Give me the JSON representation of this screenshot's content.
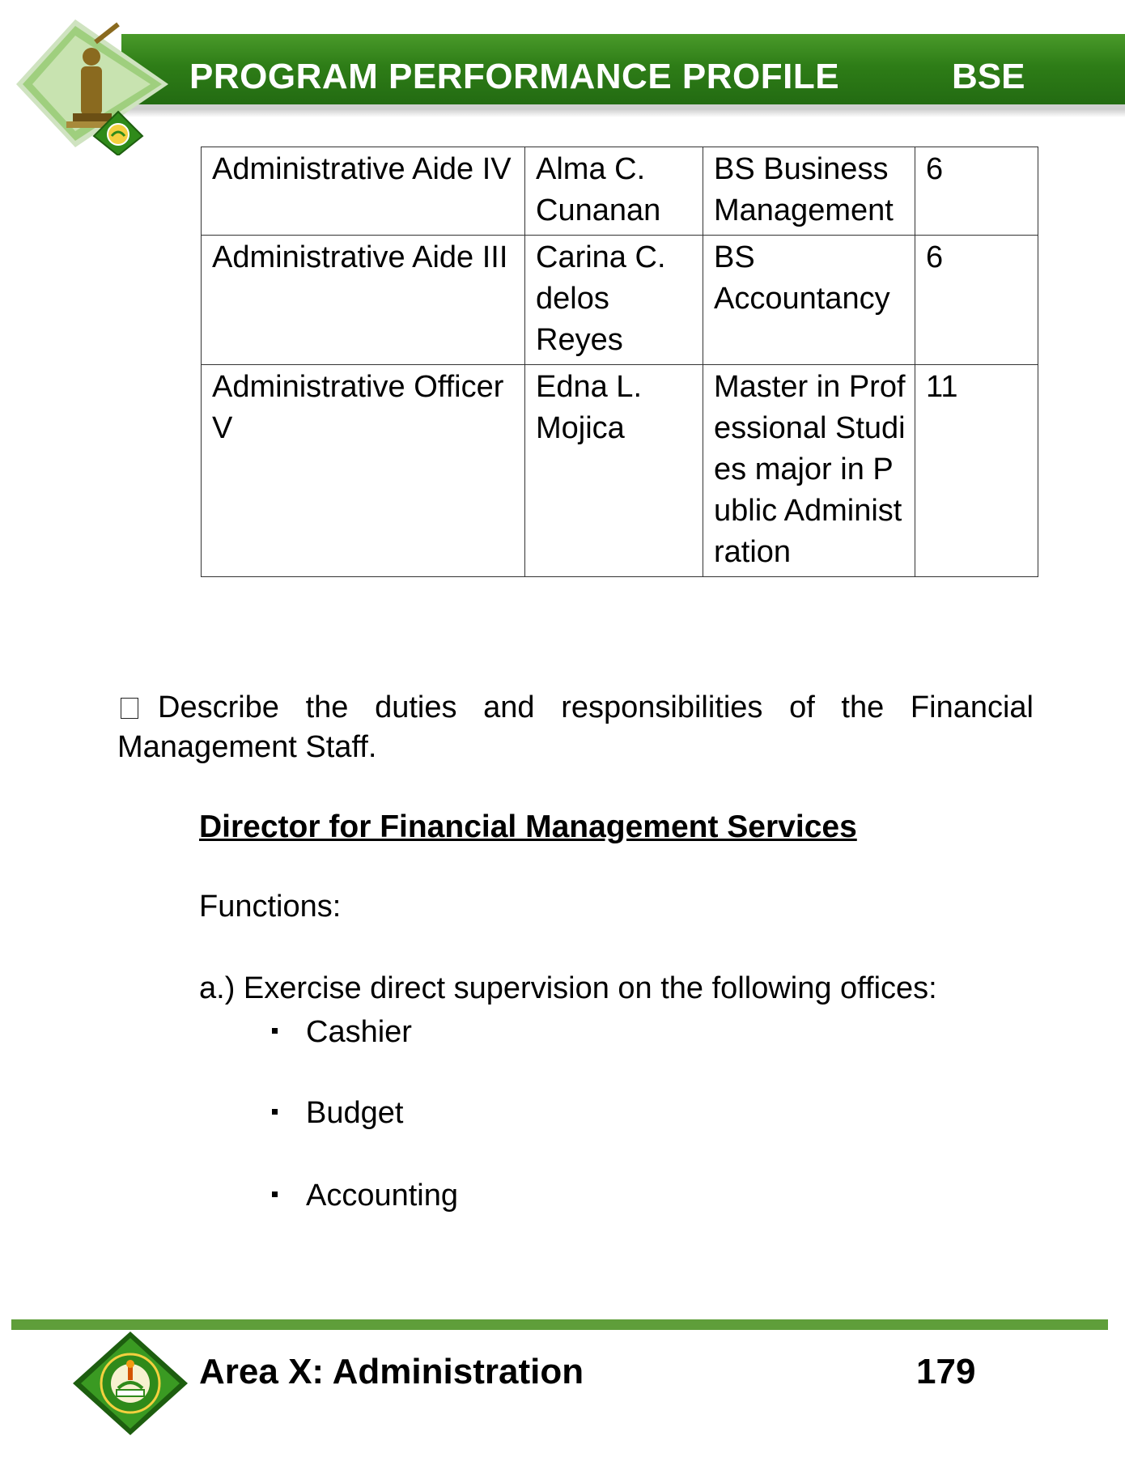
{
  "header": {
    "title": "PROGRAM PERFORMANCE PROFILE",
    "code": "BSE",
    "brand_color": "#2e7d17"
  },
  "staff_table": {
    "rows": [
      {
        "position": "Administrative Aide IV",
        "name": "Alma C. Cunanan",
        "education": "BS Business Management",
        "years": "6"
      },
      {
        "position": "Administrative Aide III",
        "name": "Carina C. delos Reyes",
        "education": "BS Accountancy",
        "years": "6"
      },
      {
        "position": "Administrative Officer V",
        "name": "Edna L. Mojica",
        "education": "Master in Professional Studies major in Public Administration",
        "years": "11"
      }
    ]
  },
  "question": "Describe the duties and responsibilities of the Financial Management Staff.",
  "section_heading": "Director for Financial Management Services",
  "functions_label": "Functions:",
  "item_a": "a.) Exercise direct supervision on the following offices:",
  "offices": [
    "Cashier",
    "Budget",
    "Accounting"
  ],
  "footer": {
    "title": "Area X: Administration",
    "page_number": "179",
    "line_color": "#5f9e3a"
  }
}
